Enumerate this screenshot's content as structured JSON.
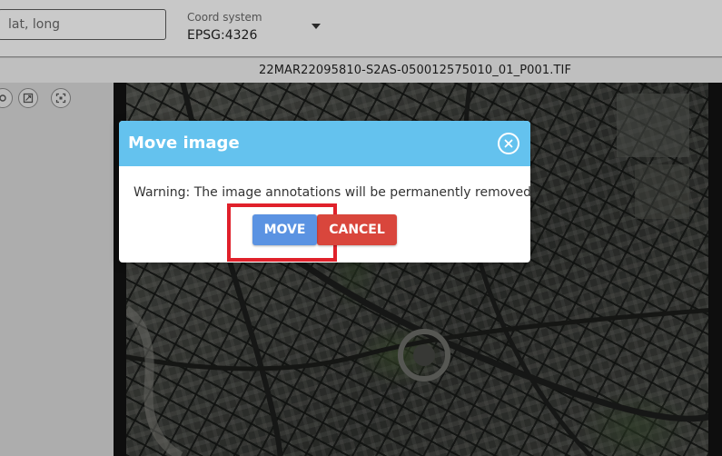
{
  "toolbar": {
    "coord_input_placeholder": "lat, long",
    "coord_system_label": "Coord system",
    "coord_system_value": "EPSG:4326"
  },
  "filebar": {
    "filename": "22MAR22095810-S2AS-050012575010_01_P001.TIF"
  },
  "tools": [
    {
      "icon": "zoom-icon"
    },
    {
      "icon": "expand-icon"
    },
    {
      "icon": "fit-extent-icon"
    }
  ],
  "modal": {
    "title": "Move image",
    "message": "Warning: The image annotations will be permanently removed!",
    "move_label": "MOVE",
    "cancel_label": "CANCEL",
    "close_icon": "close-icon"
  },
  "colors": {
    "modal_header": "#64c2ee",
    "move_button": "#5b93e2",
    "cancel_button": "#d9463c",
    "highlight": "#e0212b"
  }
}
